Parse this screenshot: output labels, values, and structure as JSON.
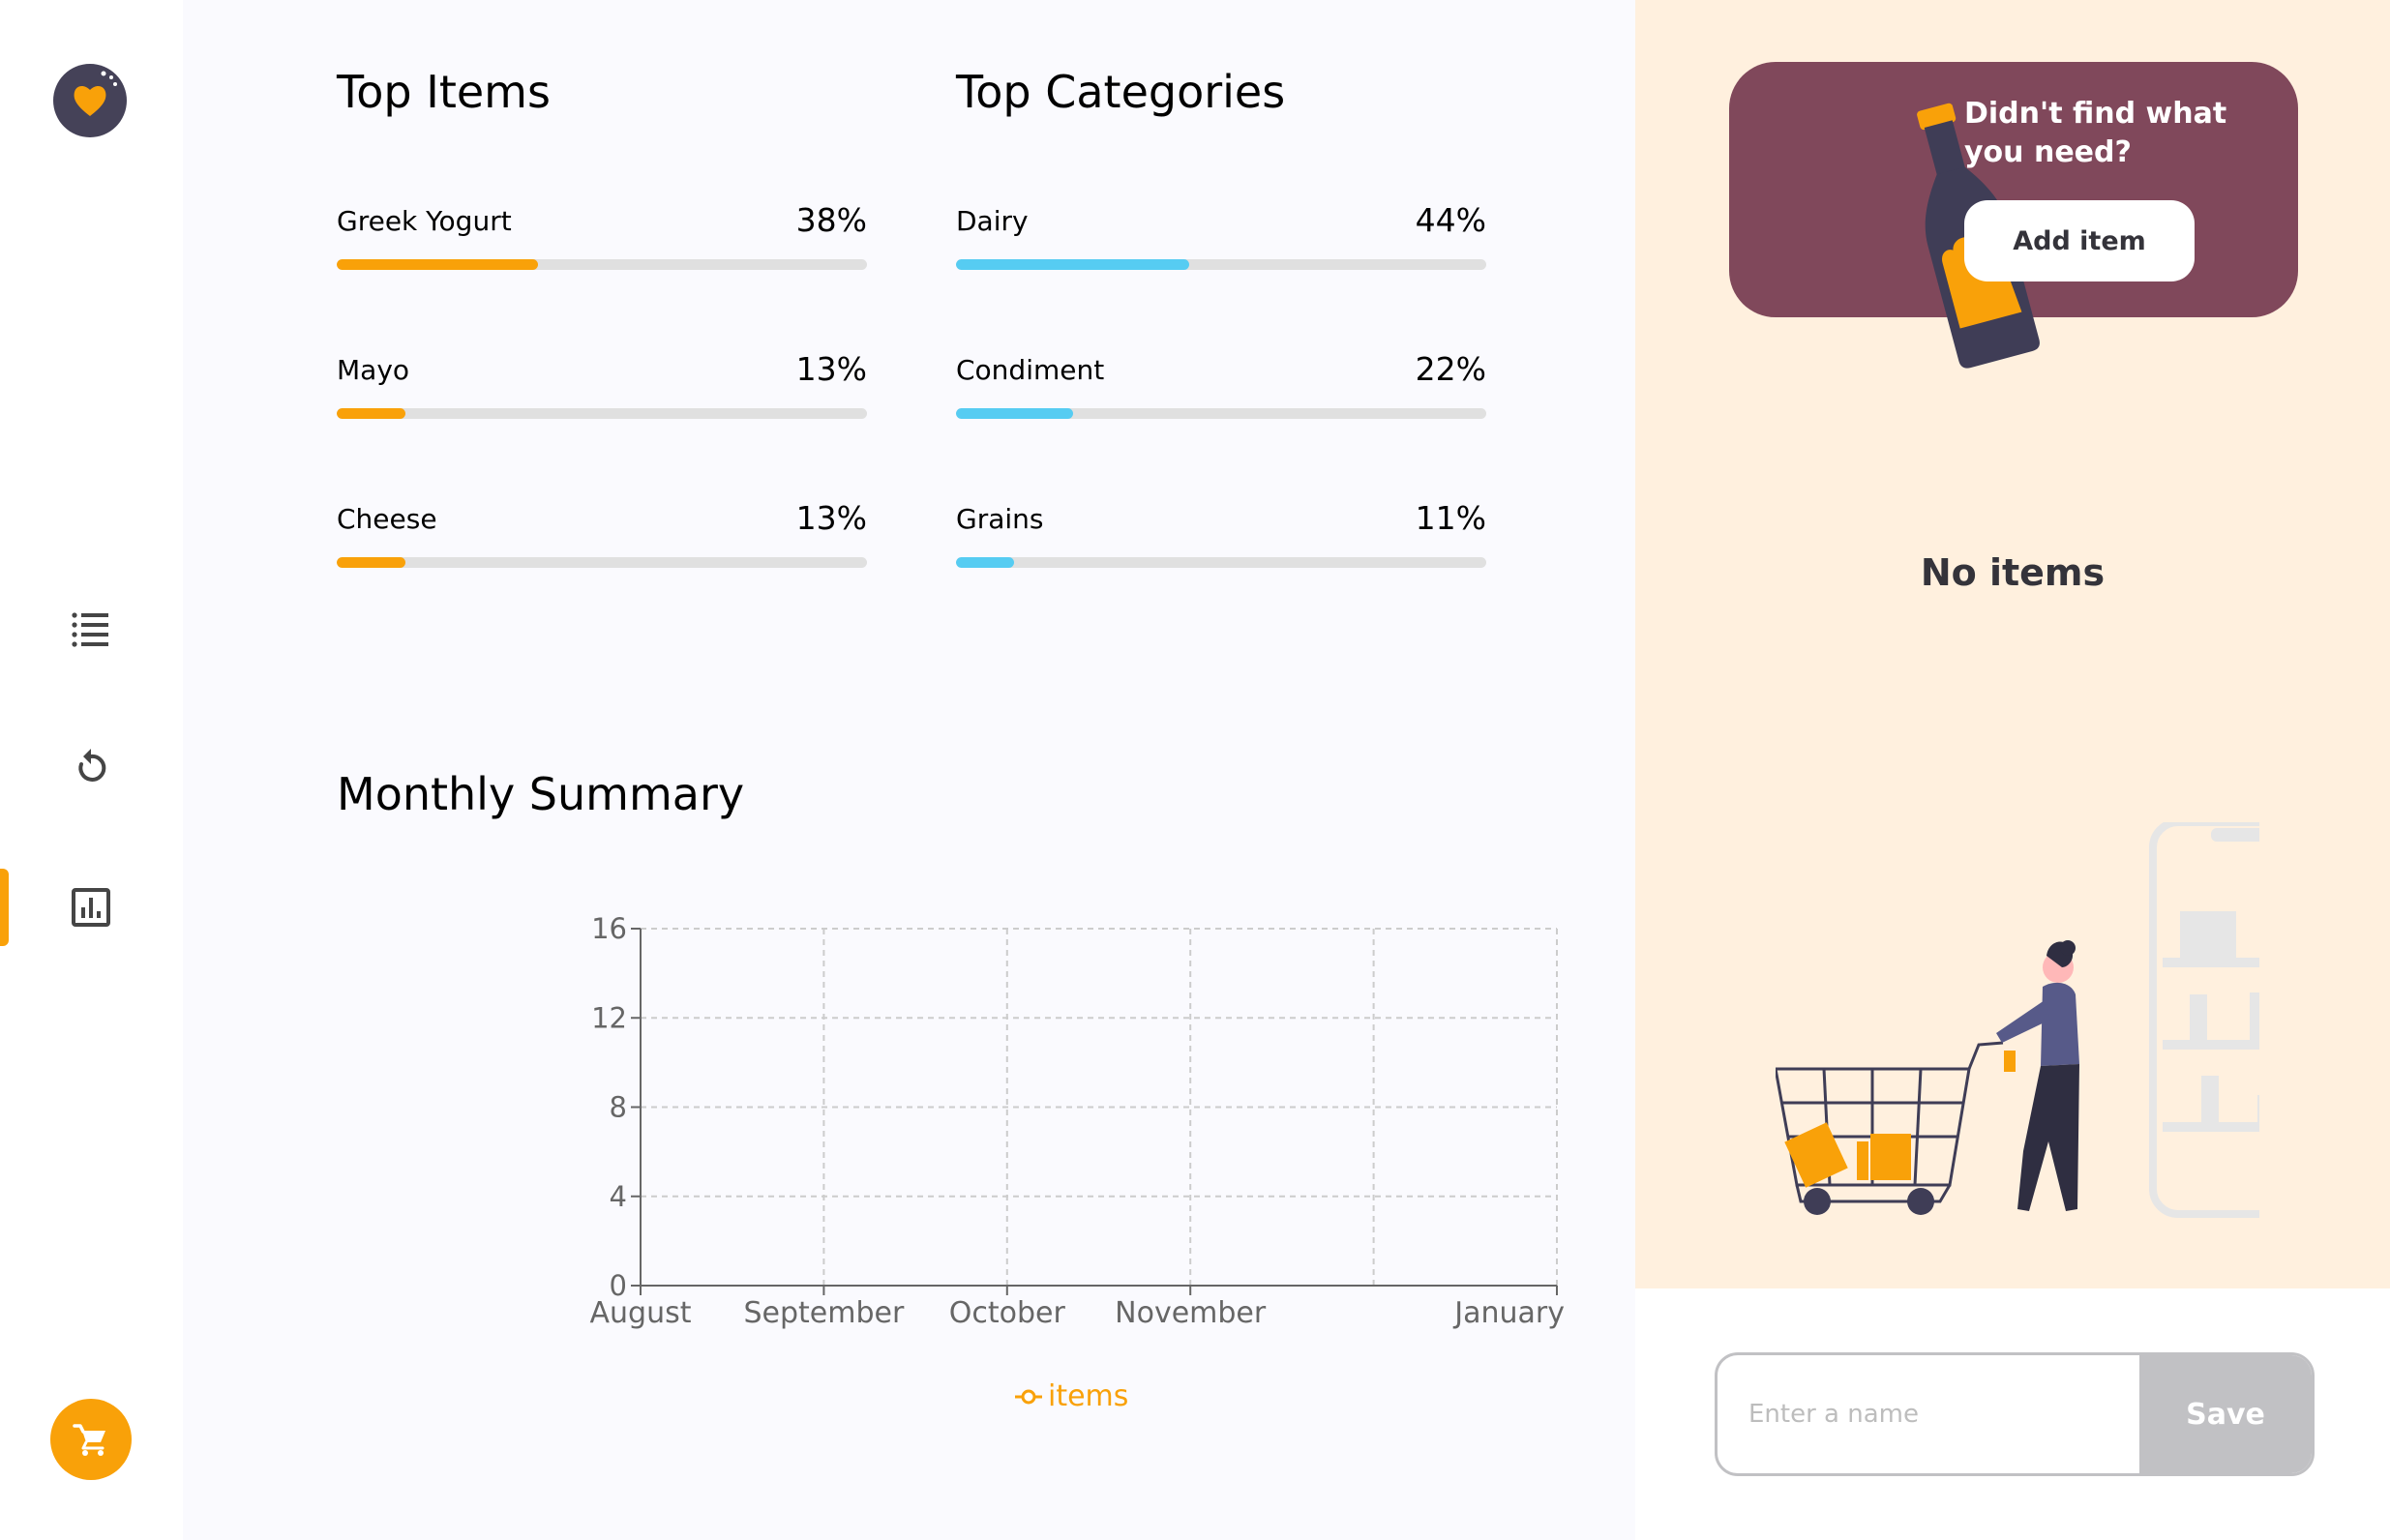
{
  "sidebar": {
    "items": [
      {
        "icon": "list-icon"
      },
      {
        "icon": "history-icon"
      },
      {
        "icon": "statistics-icon",
        "active": true
      }
    ],
    "accent_color": "#f9a109"
  },
  "top_items": {
    "title": "Top Items",
    "items": [
      {
        "label": "Greek Yogurt",
        "value": "38%",
        "percent": 38
      },
      {
        "label": "Mayo",
        "value": "13%",
        "percent": 13
      },
      {
        "label": "Cheese",
        "value": "13%",
        "percent": 13
      }
    ],
    "bar_color": "#f9a109"
  },
  "top_categories": {
    "title": "Top Categories",
    "items": [
      {
        "label": "Dairy",
        "value": "44%",
        "percent": 44
      },
      {
        "label": "Condiment",
        "value": "22%",
        "percent": 22
      },
      {
        "label": "Grains",
        "value": "11%",
        "percent": 11
      }
    ],
    "bar_color": "#56ccf2"
  },
  "monthly_summary": {
    "title": "Monthly Summary"
  },
  "chart_data": {
    "type": "line",
    "title": "",
    "xlabel": "",
    "ylabel": "",
    "categories": [
      "August",
      "September",
      "October",
      "November",
      "January"
    ],
    "x_tick_positions": [
      0,
      1,
      2,
      3,
      5
    ],
    "x_range": [
      0,
      5
    ],
    "yticks": [
      0,
      4,
      8,
      12,
      16
    ],
    "ylim": [
      0,
      16
    ],
    "grid": true,
    "legend_position": "bottom",
    "series": [
      {
        "name": "items",
        "color": "#f9a109",
        "values": []
      }
    ]
  },
  "promo": {
    "text": "Didn't find what you need?",
    "button_label": "Add item",
    "background_color": "#80485b"
  },
  "shopping_list": {
    "empty_text": "No items"
  },
  "name_form": {
    "placeholder": "Enter a name",
    "value": "",
    "save_label": "Save"
  }
}
